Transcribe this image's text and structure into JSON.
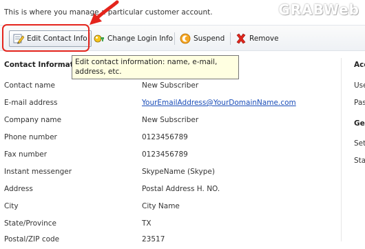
{
  "intro_text": "This is where you manage a particular customer account.",
  "watermark": "GRABWeb",
  "toolbar": {
    "buttons": [
      {
        "label": "Edit Contact Info",
        "icon": "edit-contact-icon"
      },
      {
        "label": "Change Login Info",
        "icon": "key-login-icon"
      },
      {
        "label": "Suspend",
        "icon": "suspend-icon"
      },
      {
        "label": "Remove",
        "icon": "remove-x-icon"
      }
    ]
  },
  "tooltip": "Edit contact information: name, e-mail, address, etc.",
  "contact_section": {
    "title": "Contact Information",
    "rows": [
      {
        "label": "Contact name",
        "value": "New Subscriber"
      },
      {
        "label": "E-mail address",
        "value": "YourEmailAddress@YourDomainName.com"
      },
      {
        "label": "Company name",
        "value": "New Subscriber"
      },
      {
        "label": "Phone number",
        "value": "0123456789"
      },
      {
        "label": "Fax number",
        "value": "0123456789"
      },
      {
        "label": "Instant messenger",
        "value": "SkypeName (Skype)"
      },
      {
        "label": "Address",
        "value": "Postal Address H. NO."
      },
      {
        "label": "City",
        "value": "City Name"
      },
      {
        "label": "State/Province",
        "value": "TX"
      },
      {
        "label": "Postal/ZIP code",
        "value": "23517"
      }
    ]
  },
  "right_column": {
    "heading1": "Acc",
    "item1": "Use",
    "item2": "Pas",
    "heading2": "Ge",
    "item3": "Set",
    "item4": "Sta"
  },
  "colors": {
    "highlight": "#e4241c",
    "link": "#1a4db8",
    "tooltip_bg": "#ffffe1"
  }
}
